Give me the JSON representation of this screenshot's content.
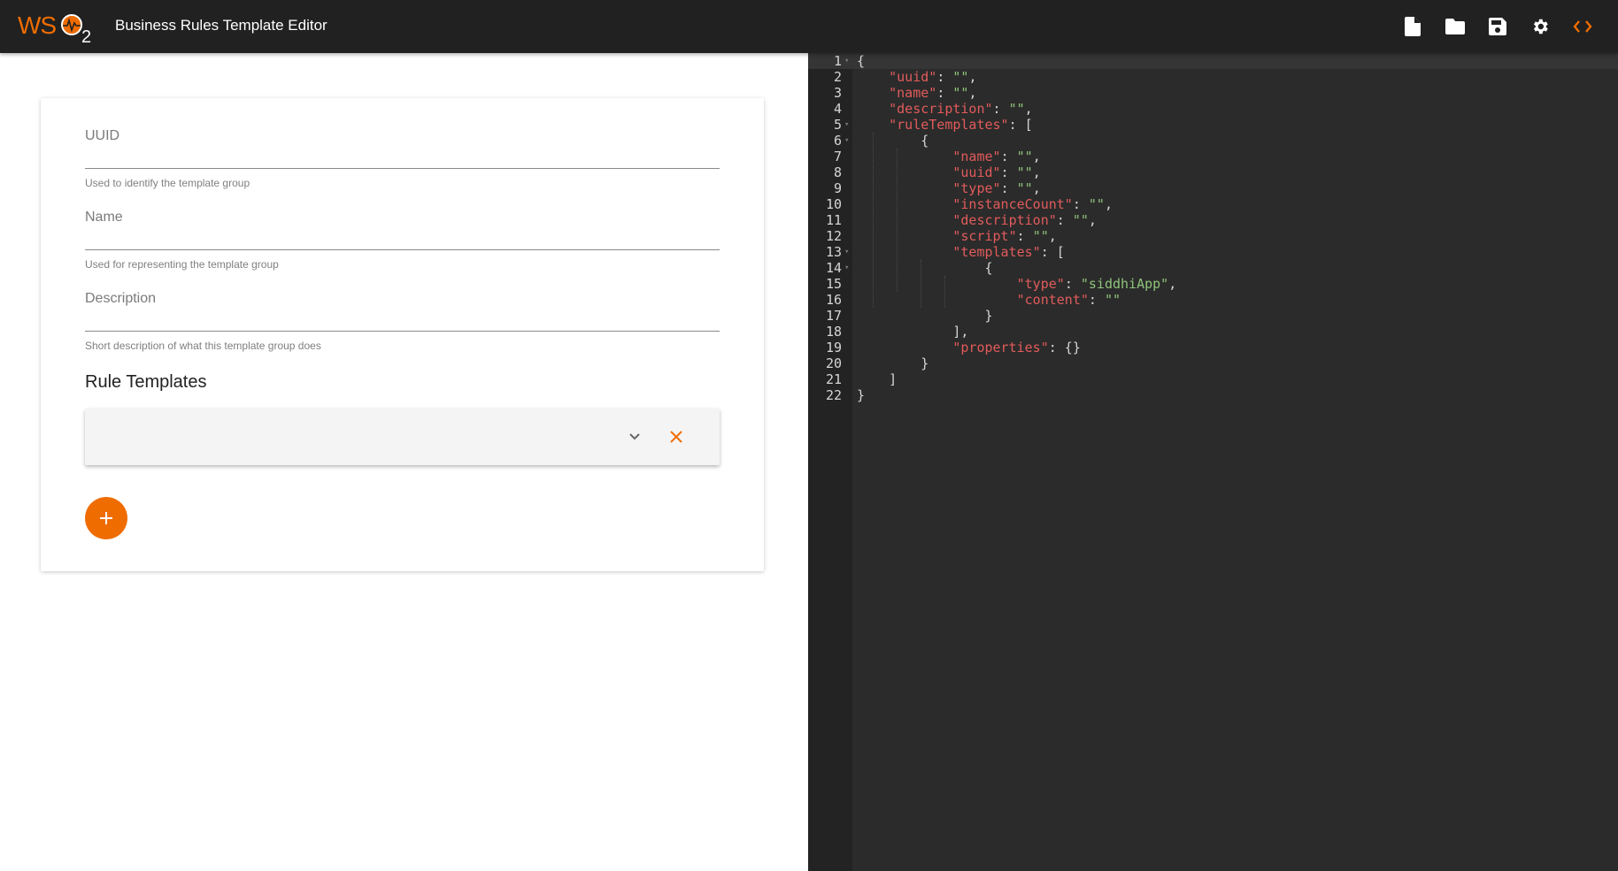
{
  "header": {
    "title": "Business Rules Template Editor",
    "logo_text": "WSO2",
    "toolbar": [
      {
        "name": "new-file",
        "icon": "file-icon",
        "label": "New"
      },
      {
        "name": "open-folder",
        "icon": "folder-icon",
        "label": "Open"
      },
      {
        "name": "save",
        "icon": "save-icon",
        "label": "Save"
      },
      {
        "name": "settings",
        "icon": "gear-icon",
        "label": "Settings"
      },
      {
        "name": "toggle-code",
        "icon": "code-icon",
        "label": "Code view"
      }
    ],
    "accent_color": "#ef6c00"
  },
  "form": {
    "uuid": {
      "label": "UUID",
      "value": "",
      "help": "Used to identify the template group"
    },
    "name": {
      "label": "Name",
      "value": "",
      "help": "Used for representing the template group"
    },
    "description": {
      "label": "Description",
      "value": "",
      "help": "Short description of what this template group does"
    },
    "rule_templates_title": "Rule Templates",
    "rule_templates": [
      {
        "name": ""
      }
    ]
  },
  "editor": {
    "lines": [
      [
        {
          "t": "p",
          "v": "{"
        }
      ],
      [
        {
          "t": "p",
          "v": "    "
        },
        {
          "t": "k",
          "v": "\"uuid\""
        },
        {
          "t": "p",
          "v": ": "
        },
        {
          "t": "s",
          "v": "\"\""
        },
        {
          "t": "p",
          "v": ","
        }
      ],
      [
        {
          "t": "p",
          "v": "    "
        },
        {
          "t": "k",
          "v": "\"name\""
        },
        {
          "t": "p",
          "v": ": "
        },
        {
          "t": "s",
          "v": "\"\""
        },
        {
          "t": "p",
          "v": ","
        }
      ],
      [
        {
          "t": "p",
          "v": "    "
        },
        {
          "t": "k",
          "v": "\"description\""
        },
        {
          "t": "p",
          "v": ": "
        },
        {
          "t": "s",
          "v": "\"\""
        },
        {
          "t": "p",
          "v": ","
        }
      ],
      [
        {
          "t": "p",
          "v": "    "
        },
        {
          "t": "k",
          "v": "\"ruleTemplates\""
        },
        {
          "t": "p",
          "v": ": ["
        }
      ],
      [
        {
          "t": "p",
          "v": "        {"
        }
      ],
      [
        {
          "t": "p",
          "v": "            "
        },
        {
          "t": "k",
          "v": "\"name\""
        },
        {
          "t": "p",
          "v": ": "
        },
        {
          "t": "s",
          "v": "\"\""
        },
        {
          "t": "p",
          "v": ","
        }
      ],
      [
        {
          "t": "p",
          "v": "            "
        },
        {
          "t": "k",
          "v": "\"uuid\""
        },
        {
          "t": "p",
          "v": ": "
        },
        {
          "t": "s",
          "v": "\"\""
        },
        {
          "t": "p",
          "v": ","
        }
      ],
      [
        {
          "t": "p",
          "v": "            "
        },
        {
          "t": "k",
          "v": "\"type\""
        },
        {
          "t": "p",
          "v": ": "
        },
        {
          "t": "s",
          "v": "\"\""
        },
        {
          "t": "p",
          "v": ","
        }
      ],
      [
        {
          "t": "p",
          "v": "            "
        },
        {
          "t": "k",
          "v": "\"instanceCount\""
        },
        {
          "t": "p",
          "v": ": "
        },
        {
          "t": "s",
          "v": "\"\""
        },
        {
          "t": "p",
          "v": ","
        }
      ],
      [
        {
          "t": "p",
          "v": "            "
        },
        {
          "t": "k",
          "v": "\"description\""
        },
        {
          "t": "p",
          "v": ": "
        },
        {
          "t": "s",
          "v": "\"\""
        },
        {
          "t": "p",
          "v": ","
        }
      ],
      [
        {
          "t": "p",
          "v": "            "
        },
        {
          "t": "k",
          "v": "\"script\""
        },
        {
          "t": "p",
          "v": ": "
        },
        {
          "t": "s",
          "v": "\"\""
        },
        {
          "t": "p",
          "v": ","
        }
      ],
      [
        {
          "t": "p",
          "v": "            "
        },
        {
          "t": "k",
          "v": "\"templates\""
        },
        {
          "t": "p",
          "v": ": ["
        }
      ],
      [
        {
          "t": "p",
          "v": "                {"
        }
      ],
      [
        {
          "t": "p",
          "v": "                    "
        },
        {
          "t": "k",
          "v": "\"type\""
        },
        {
          "t": "p",
          "v": ": "
        },
        {
          "t": "s",
          "v": "\"siddhiApp\""
        },
        {
          "t": "p",
          "v": ","
        }
      ],
      [
        {
          "t": "p",
          "v": "                    "
        },
        {
          "t": "k",
          "v": "\"content\""
        },
        {
          "t": "p",
          "v": ": "
        },
        {
          "t": "s",
          "v": "\"\""
        }
      ],
      [
        {
          "t": "p",
          "v": "                }"
        }
      ],
      [
        {
          "t": "p",
          "v": "            ],"
        }
      ],
      [
        {
          "t": "p",
          "v": "            "
        },
        {
          "t": "k",
          "v": "\"properties\""
        },
        {
          "t": "p",
          "v": ": {}"
        }
      ],
      [
        {
          "t": "p",
          "v": "        }"
        }
      ],
      [
        {
          "t": "p",
          "v": "    ]"
        }
      ],
      [
        {
          "t": "p",
          "v": "}"
        }
      ]
    ],
    "foldable_lines": [
      1,
      5,
      6,
      13,
      14
    ],
    "active_line": 1
  }
}
